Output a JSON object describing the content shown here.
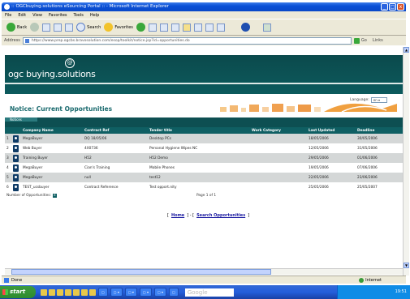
{
  "window": {
    "title": ":: OGCbuying.solutions eSourcing Portal :: - Microsoft Internet Explorer",
    "controls": [
      "_",
      "□",
      "x"
    ]
  },
  "menu": [
    "File",
    "Edit",
    "View",
    "Favorites",
    "Tools",
    "Help"
  ],
  "toolbar": {
    "back_label": "Back",
    "search_label": "Search",
    "favorites_label": "Favorites"
  },
  "address": {
    "label": "Address",
    "url": "https://www.prep.ogcbs.bravosolution.com/esop/toolkit/notice.jsp?id=opportunities.do",
    "go_label": "Go",
    "links_label": "Links"
  },
  "site": {
    "logo_mark": "@",
    "logo_text": "ogc buying.solutions",
    "language_label": "Language:",
    "language_value": "en",
    "page_title": "Notice: Current Opportunities",
    "section_tab": "Notices"
  },
  "table": {
    "headers": [
      "",
      "",
      "Company Name",
      "Contract Ref",
      "Tender title",
      "Work Category",
      "Last Updated",
      "Deadline"
    ],
    "rows": [
      {
        "num": "1",
        "company": "MegaBuyer",
        "ref": "DQ 18/05/06",
        "title": "Desktop PCs",
        "category": "",
        "updated": "18/05/2006",
        "deadline": "30/05/2006"
      },
      {
        "num": "2",
        "company": "Web Buyer",
        "ref": "4X0736",
        "title": "Personal Hygiene Wipes NC",
        "category": "",
        "updated": "12/05/2006",
        "deadline": "31/05/2006"
      },
      {
        "num": "3",
        "company": "Training Buyer",
        "ref": "H52",
        "title": "H52 Demo",
        "category": "",
        "updated": "29/05/2006",
        "deadline": "01/06/2006"
      },
      {
        "num": "4",
        "company": "MegaBuyer",
        "ref": "Cian's Training",
        "title": "Mobile Phones",
        "category": "",
        "updated": "19/05/2006",
        "deadline": "07/06/2006"
      },
      {
        "num": "5",
        "company": "MegaBuyer",
        "ref": "null",
        "title": "test12",
        "category": "",
        "updated": "22/05/2006",
        "deadline": "23/06/2006"
      },
      {
        "num": "6",
        "company": "TEST_ucsbuyer",
        "ref": "Contract Reference",
        "title": "Test opport.nity",
        "category": "",
        "updated": "25/05/2006",
        "deadline": "25/05/2007"
      }
    ]
  },
  "footer": {
    "count_label": "Number of Opportunities:",
    "count_value": "6",
    "pager": "Page 1 of 1"
  },
  "links": {
    "home": "Home",
    "search": "Search Opportunities",
    "sep_open": "[",
    "sep_mid": "] - [",
    "sep_close": "]"
  },
  "status": {
    "text": "Done",
    "zone": "Internet"
  },
  "taskbar": {
    "start": "start",
    "google": "Google",
    "clock": "19:51"
  }
}
